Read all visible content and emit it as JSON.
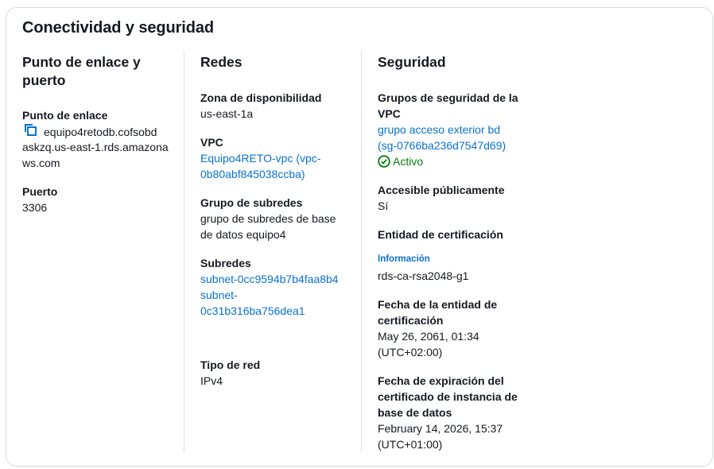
{
  "panel": {
    "title": "Conectividad y seguridad"
  },
  "endpoint_port": {
    "title_line1": "Punto de enlace y",
    "title_line2": "puerto",
    "endpoint_label": "Punto de enlace",
    "endpoint_line1": "equipo4retodb.cofsobd",
    "endpoint_line2": "askzq.us-east-1.rds.amazona",
    "endpoint_line3": "ws.com",
    "port_label": "Puerto",
    "port_value": "3306"
  },
  "networks": {
    "title": "Redes",
    "az_label": "Zona de disponibilidad",
    "az_value": "us-east-1a",
    "vpc_label": "VPC",
    "vpc_line1": "Equipo4RETO-vpc (vpc-",
    "vpc_line2": "0b80abf845038ccba)",
    "subnet_group_label": "Grupo de subredes",
    "subnet_group_line1": "grupo de subredes de base",
    "subnet_group_line2": "de datos equipo4",
    "subnets_label": "Subredes",
    "subnet1": "subnet-0cc9594b7b4faa8b4",
    "subnet2_line1": "subnet-",
    "subnet2_line2": "0c31b316ba756dea1",
    "network_type_label": "Tipo de red",
    "network_type_value": "IPv4"
  },
  "security": {
    "title": "Seguridad",
    "sg_label_line1": "Grupos de seguridad de la",
    "sg_label_line2": "VPC",
    "sg_line1": "grupo acceso exterior bd",
    "sg_line2": "(sg-0766ba236d7547d69)",
    "sg_status": "Activo",
    "public_label": "Accesible públicamente",
    "public_value": "Sí",
    "ca_label": "Entidad de certificación",
    "ca_info": "Información",
    "ca_value": "rds-ca-rsa2048-g1",
    "ca_date_label_line1": "Fecha de la entidad de",
    "ca_date_label_line2": "certificación",
    "ca_date_line1": "May 26, 2061, 01:34",
    "ca_date_line2": "(UTC+02:00)",
    "exp_label_line1": "Fecha de expiración del",
    "exp_label_line2": "certificado de instancia de",
    "exp_label_line3": "base de datos",
    "exp_line1": "February 14, 2026, 15:37",
    "exp_line2": "(UTC+01:00)"
  },
  "colors": {
    "link": "#0972d3",
    "success": "#037f0c",
    "border": "#d5dbdb",
    "text": "#16191f"
  },
  "icons": {
    "copy": "copy-icon",
    "status": "check-circle-icon"
  }
}
